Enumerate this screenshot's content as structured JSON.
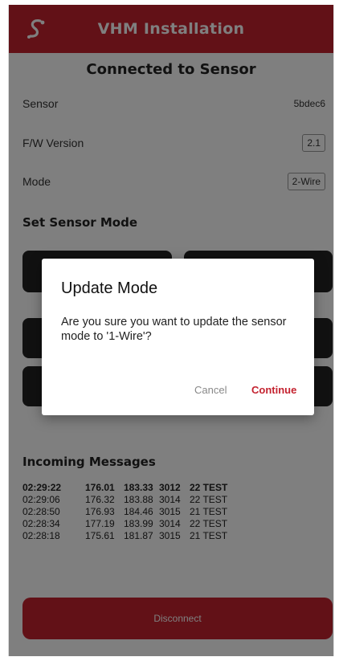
{
  "colors": {
    "brand": "#c4222f",
    "button_dark": "#222222"
  },
  "header": {
    "title": "VHM Installation",
    "logo_icon": "s-logo-icon"
  },
  "main": {
    "title": "Connected to Sensor",
    "sensor": {
      "label": "Sensor",
      "value": "5bdec6"
    },
    "firmware": {
      "label": "F/W Version",
      "value": "2.1"
    },
    "mode": {
      "label": "Mode",
      "value": "2-Wire"
    },
    "set_mode_heading": "Set Sensor Mode"
  },
  "messages": {
    "heading": "Incoming Messages",
    "rows": [
      [
        "02:29:22",
        "176.01",
        "183.33",
        "3012",
        "22 TEST"
      ],
      [
        "02:29:06",
        "176.32",
        "183.88",
        "3014",
        "22 TEST"
      ],
      [
        "02:28:50",
        "176.93",
        "184.46",
        "3015",
        "21 TEST"
      ],
      [
        "02:28:34",
        "177.19",
        "183.99",
        "3014",
        "22 TEST"
      ],
      [
        "02:28:18",
        "175.61",
        "181.87",
        "3015",
        "21 TEST"
      ]
    ]
  },
  "disconnect_label": "Disconnect",
  "dialog": {
    "title": "Update Mode",
    "message": "Are you sure you want to update the sensor mode to '1-Wire'?",
    "cancel_label": "Cancel",
    "continue_label": "Continue"
  }
}
